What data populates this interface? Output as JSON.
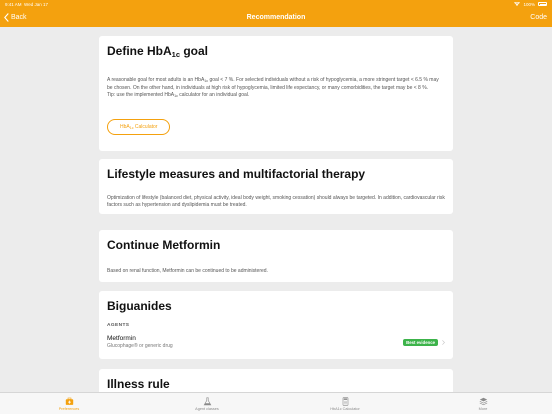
{
  "status_bar": {
    "time": "9:41 AM",
    "date": "Wed Jan 17",
    "wifi": "wifi-icon",
    "battery_text": "100%",
    "battery": "battery-icon"
  },
  "nav": {
    "back_label": "Back",
    "back_icon": "chevron-left-icon",
    "title": "Recommendation",
    "right_label": "Code"
  },
  "cards": {
    "goal": {
      "title_main": "Define HbA",
      "title_sub": "1c",
      "title_tail": " goal",
      "p1_a": "A reasonable goal for most adults is an HbA",
      "p1_sub": "1c",
      "p1_b": " goal < 7 %. For selected individuals without a risk of hypoglycemia, a more stringent target < 6.5 % may be chosen. On the other hand, in individuals at high risk of hypoglycemia, limited life expectancy, or many comorbidities, the target may be < 8 %.",
      "p2_a": "Tip: use the implemented HbA",
      "p2_sub": "1c",
      "p2_b": " calculator for an individual goal.",
      "button_a": "HbA",
      "button_sub": "1c",
      "button_b": " Calculator"
    },
    "lifestyle": {
      "title": "Lifestyle measures and multifactorial therapy",
      "body": "Optimization of lifestyle (balanced diet, physical activity, ideal body weight, smoking cessation) should always be targeted. In addition, cardiovascular risk factors such as hypertension and dyslipidemia must be treated."
    },
    "metformin": {
      "title": "Continue Metformin",
      "body": "Based on renal function, Metformin can be continued to be administered."
    },
    "biguanides": {
      "title": "Biguanides",
      "section": "AGENTS",
      "drug_name": "Metformin",
      "drug_sub": "Glucophage® or generic drug",
      "badge": "Best evidence",
      "badge_color": "#3cb34a"
    },
    "illness": {
      "title": "Illness rule"
    }
  },
  "tabs": [
    {
      "label": "Preferences",
      "icon": "briefcase-medical-icon",
      "active": true
    },
    {
      "label": "Agent classes",
      "icon": "flask-icon",
      "active": false
    },
    {
      "label": "HbA1c Calculator",
      "icon": "calculator-icon",
      "active": false
    },
    {
      "label": "More",
      "icon": "layers-icon",
      "active": false
    }
  ],
  "colors": {
    "accent": "#f4a10e",
    "background": "#ececec",
    "card": "#ffffff",
    "evidence": "#3cb34a"
  }
}
